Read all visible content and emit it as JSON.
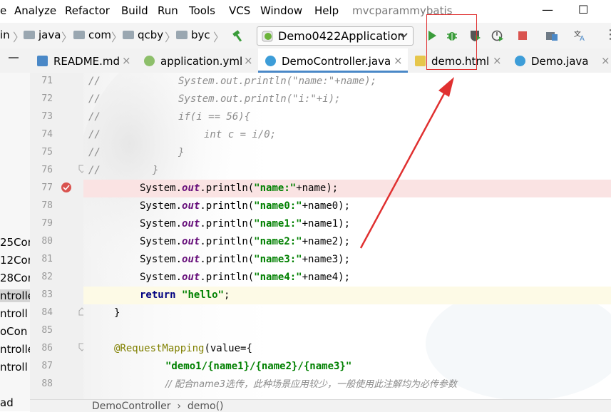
{
  "menubar": {
    "items": [
      "e",
      "Analyze",
      "Refactor",
      "Build",
      "Run",
      "Tools",
      "VCS",
      "Window",
      "Help"
    ],
    "project_title": "mvcparammybatis",
    "minimize": "—",
    "maximize": "☐"
  },
  "navbar": {
    "breadcrumbs": [
      "in",
      "java",
      "com",
      "qcby",
      "byc"
    ],
    "run_config": "Demo0422Application",
    "toolbar_icons": [
      "hammer-icon",
      "run-icon",
      "debug-icon",
      "coverage-icon",
      "profile-icon",
      "stop-icon",
      "project-structure-icon",
      "translate-icon"
    ]
  },
  "tabs": [
    {
      "label": "README.md",
      "close": "×"
    },
    {
      "label": "application.yml",
      "close": "×"
    },
    {
      "label": "DemoController.java",
      "close": "×",
      "active": true
    },
    {
      "label": "demo.html",
      "close": "×"
    },
    {
      "label": "Demo.java",
      "close": "×"
    }
  ],
  "left_panel": {
    "items": [
      "25Con",
      "12Con",
      "28Con",
      "ntrolle",
      "ntroll",
      "oCon",
      "ntrolle",
      "ntroll",
      "ad"
    ]
  },
  "editor": {
    "line_numbers": [
      "71",
      "72",
      "73",
      "74",
      "75",
      "76",
      "77",
      "78",
      "79",
      "80",
      "81",
      "82",
      "83",
      "84",
      "85",
      "86",
      "87",
      "88"
    ],
    "lines": {
      "l71_cm": "//",
      "l71_code": "System.out.println(\"name:\"+name);",
      "l72_cm": "//",
      "l72_code": "System.out.println(\"i:\"+i);",
      "l73_cm": "//",
      "l73_code": "if(i == 56){",
      "l74_cm": "//",
      "l74_code": "int c = i/0;",
      "l75_cm": "//",
      "l75_code": "}",
      "l76_cm": "//",
      "l76_code": "}",
      "sys": "System.",
      "out": "out",
      "println": ".println(",
      "l77_str": "\"name:\"",
      "l77_rest": "+name);",
      "l78_str": "\"name0:\"",
      "l78_rest": "+name0);",
      "l79_str": "\"name1:\"",
      "l79_rest": "+name1);",
      "l80_str": "\"name2:\"",
      "l80_rest": "+name2);",
      "l81_str": "\"name3:\"",
      "l81_rest": "+name3);",
      "l82_str": "\"name4:\"",
      "l82_rest": "+name4);",
      "l83_kw": "return",
      "l83_str": "\"hello\"",
      "l83_rest": ";",
      "l84": "}",
      "l86_an": "@RequestMapping",
      "l86_rest": "(value={",
      "l87_str": "\"demo1/{name1}/{name2}/{name3}\"",
      "l88_cm": "// 配合name3选传，此种场景应用较少，一般使用此注解均为必传参数"
    }
  },
  "bottom_breadcrumb": "DemoController  ›  demo()",
  "colors": {
    "accent": "#4a88c7",
    "annotation_red": "#e03030",
    "breakpoint": "#d9534f",
    "run_green": "#3a9c3a"
  }
}
